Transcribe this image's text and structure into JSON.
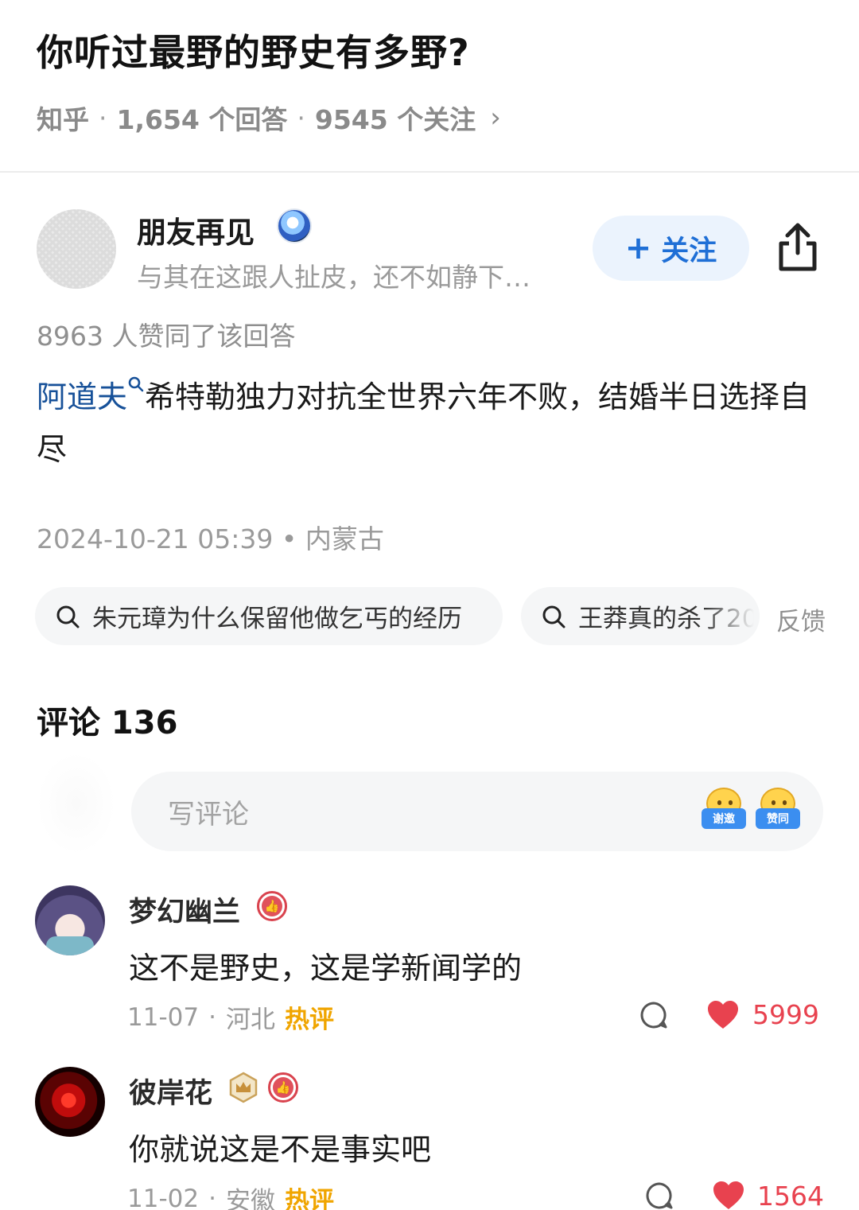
{
  "question": {
    "title": "你听过最野的野史有多野?",
    "source": "知乎",
    "answers": "1,654 个回答",
    "followers": "9545 个关注",
    "chevron": "›"
  },
  "author": {
    "name": "朋友再见",
    "bio": "与其在这跟人扯皮，还不如静下…",
    "follow_label": "关注",
    "follow_plus": "+"
  },
  "answer": {
    "upvotes": "8963 人赞同了该回答",
    "link_text": "阿道夫",
    "body": "希特勒独力对抗全世界六年不败，结婚半日选择自尽",
    "timestamp": "2024-10-21 05:39 • 内蒙古"
  },
  "related_searches": {
    "items": [
      "朱元璋为什么保留他做乞丐的经历",
      "王莽真的杀了20"
    ],
    "feedback": "反馈"
  },
  "comments": {
    "title": "评论 136",
    "input_placeholder": "写评论",
    "emoji_tags": [
      "谢邀",
      "赞同"
    ],
    "items": [
      {
        "name": "梦幻幽兰",
        "text": "这不是野史，这是学新闻学的",
        "date": "11-07",
        "location": "河北",
        "tag": "热评",
        "likes": "5999"
      },
      {
        "name": "彼岸花",
        "text": "你就说这是不是事实吧",
        "date": "11-02",
        "location": "安徽",
        "tag": "热评",
        "likes": "1564"
      }
    ]
  },
  "icons": {
    "share": "share-icon",
    "search": "search-icon",
    "reply": "comment-bubble-icon",
    "like": "heart-icon",
    "badge_like": "thumbs-up-badge-icon",
    "badge_crown": "crown-badge-icon"
  },
  "colors": {
    "link": "#175199",
    "follow_bg": "#ebf3fd",
    "follow_text": "#1f6fd6",
    "hot_tag": "#f0a500",
    "like": "#e8424f"
  }
}
